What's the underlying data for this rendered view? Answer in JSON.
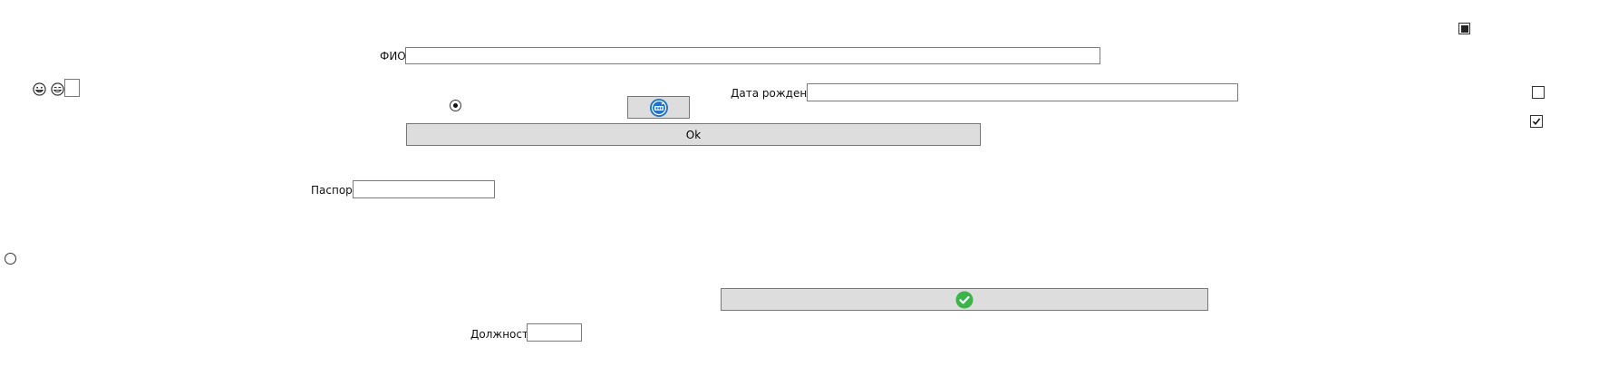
{
  "form": {
    "fio_label": "ФИО",
    "fio_value": "",
    "birthdate_label": "Дата рождения",
    "birthdate_value": "",
    "passport_label": "Паспорт",
    "passport_value": "",
    "position_label": "Должность",
    "position_value": ""
  },
  "buttons": {
    "ok_label": "Ok",
    "image_button_icon": "scanner-badge-icon",
    "confirm_button_icon": "green-check-icon"
  },
  "controls": {
    "top_checkbox_state": "indeterminate",
    "right_checkbox_1_checked": false,
    "right_checkbox_2_checked": true,
    "radio_1_selected": true,
    "radio_2_selected": false
  },
  "icons": {
    "emoji_1": "grinning-face-icon",
    "emoji_2": "smiling-face-icon"
  },
  "colors": {
    "button_bg": "#dddddd",
    "border": "#7a7a7a",
    "check_green": "#3cb44a",
    "badge_blue": "#1e73c8"
  }
}
